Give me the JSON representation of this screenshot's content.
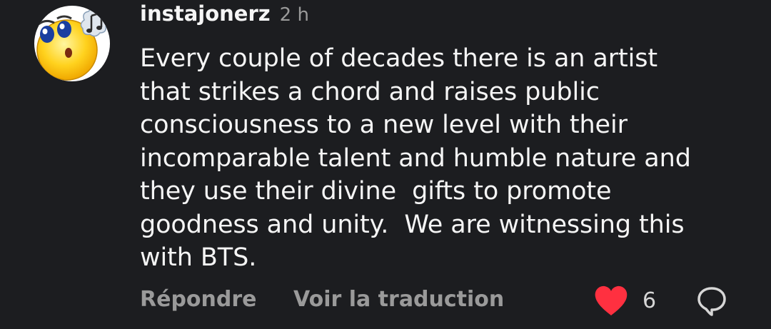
{
  "comment": {
    "username": "instajonerz",
    "timestamp": "2 h",
    "text": "Every couple of decades there is an artist\nthat strikes a chord and raises public\nconsciousness to a new level with their\nincomparable talent and humble nature and\nthey use their divine  gifts to promote\ngoodness and unity.  We are witnessing this\nwith BTS.",
    "avatar_icon": "emoji-music-face-icon"
  },
  "actions": {
    "reply_label": "Répondre",
    "translate_label": "Voir la traduction",
    "like_count": "6",
    "like_icon": "heart-filled-icon",
    "reply_icon": "speech-bubble-icon"
  },
  "colors": {
    "background": "#1c1d20",
    "text": "#f5f5f5",
    "muted": "#9a9a9a",
    "like": "#ff3040"
  }
}
